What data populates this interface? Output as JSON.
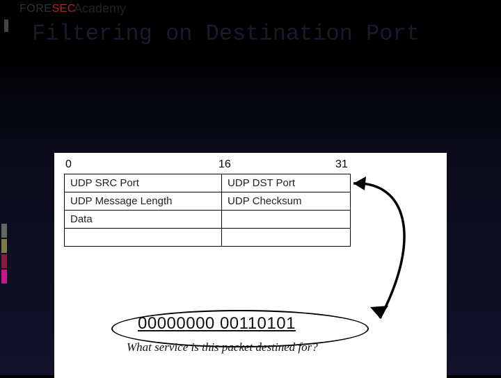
{
  "brand": {
    "fore": "FORE",
    "sec": "SEC",
    "academy": "Academy"
  },
  "title": "Filtering on Destination Port",
  "scale": {
    "start": "0",
    "mid": "16",
    "end": "31"
  },
  "table": {
    "r1c1": "UDP SRC Port",
    "r1c2": "UDP DST Port",
    "r2c1": "UDP Message Length",
    "r2c2": "UDP Checksum",
    "r3c1": "Data",
    "r3c2": "",
    "r4c1": "",
    "r4c2": ""
  },
  "binary": "00000000 00110101",
  "caption": "What service is this packet destined for?"
}
